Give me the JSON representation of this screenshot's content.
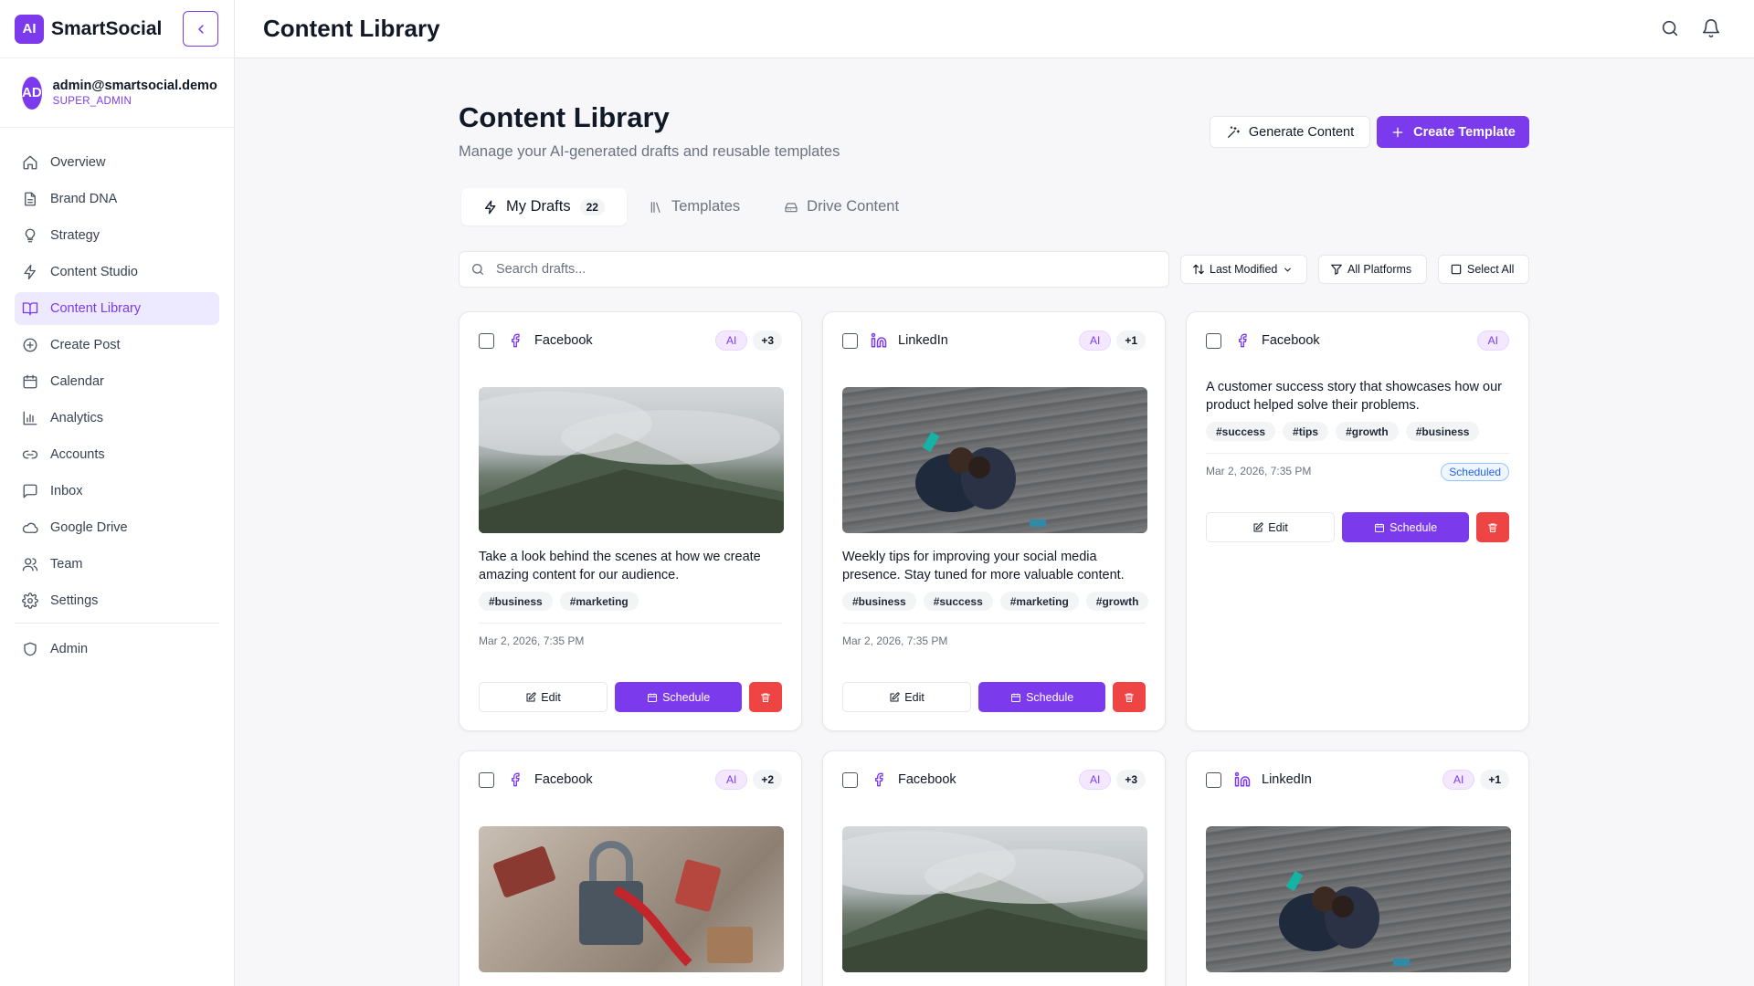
{
  "brand": {
    "logo": "AI",
    "name": "SmartSocial"
  },
  "user": {
    "initials": "AD",
    "email": "admin@smartsocial.demo",
    "role": "SUPER_ADMIN"
  },
  "nav": [
    {
      "label": "Overview",
      "icon": "home-icon"
    },
    {
      "label": "Brand DNA",
      "icon": "document-icon"
    },
    {
      "label": "Strategy",
      "icon": "lightbulb-icon"
    },
    {
      "label": "Content Studio",
      "icon": "lightning-icon"
    },
    {
      "label": "Content Library",
      "icon": "book-icon",
      "active": true
    },
    {
      "label": "Create Post",
      "icon": "plus-circle-icon"
    },
    {
      "label": "Calendar",
      "icon": "calendar-icon"
    },
    {
      "label": "Analytics",
      "icon": "bar-chart-icon"
    },
    {
      "label": "Accounts",
      "icon": "link-icon"
    },
    {
      "label": "Inbox",
      "icon": "message-icon"
    },
    {
      "label": "Google Drive",
      "icon": "cloud-icon"
    },
    {
      "label": "Team",
      "icon": "users-icon"
    },
    {
      "label": "Settings",
      "icon": "gear-icon"
    }
  ],
  "nav_admin": {
    "label": "Admin",
    "icon": "shield-icon"
  },
  "header": {
    "title": "Content Library"
  },
  "page": {
    "title": "Content Library",
    "subtitle": "Manage your AI-generated drafts and reusable templates",
    "generate_label": "Generate Content",
    "create_label": "Create Template"
  },
  "tabs": [
    {
      "label": "My Drafts",
      "count": "22",
      "active": true
    },
    {
      "label": "Templates"
    },
    {
      "label": "Drive Content"
    }
  ],
  "search": {
    "placeholder": "Search drafts..."
  },
  "filters": {
    "sort": "Last Modified",
    "platforms": "All Platforms",
    "select_all": "Select All"
  },
  "card_labels": {
    "ai": "AI",
    "edit": "Edit",
    "schedule": "Schedule"
  },
  "cards": [
    {
      "platform": "Facebook",
      "extra": "+3",
      "image": "mountain",
      "text": "Take a look behind the scenes at how we create amazing content for our audience.",
      "tags": [
        "#business",
        "#marketing"
      ],
      "date": "Mar 2, 2026, 7:35 PM"
    },
    {
      "platform": "LinkedIn",
      "extra": "+1",
      "image": "people",
      "text": "Weekly tips for improving your social media presence. Stay tuned for more valuable content.",
      "tags": [
        "#business",
        "#success",
        "#marketing",
        "#growth"
      ],
      "date": "Mar 2, 2026, 7:35 PM"
    },
    {
      "platform": "Facebook",
      "text": "A customer success story that showcases how our product helped solve their problems.",
      "tags": [
        "#success",
        "#tips",
        "#growth",
        "#business"
      ],
      "date": "Mar 2, 2026, 7:35 PM",
      "status": "Scheduled"
    },
    {
      "platform": "Facebook",
      "extra": "+2",
      "image": "locks"
    },
    {
      "platform": "Facebook",
      "extra": "+3",
      "image": "mountain"
    },
    {
      "platform": "LinkedIn",
      "extra": "+1",
      "image": "people"
    }
  ]
}
